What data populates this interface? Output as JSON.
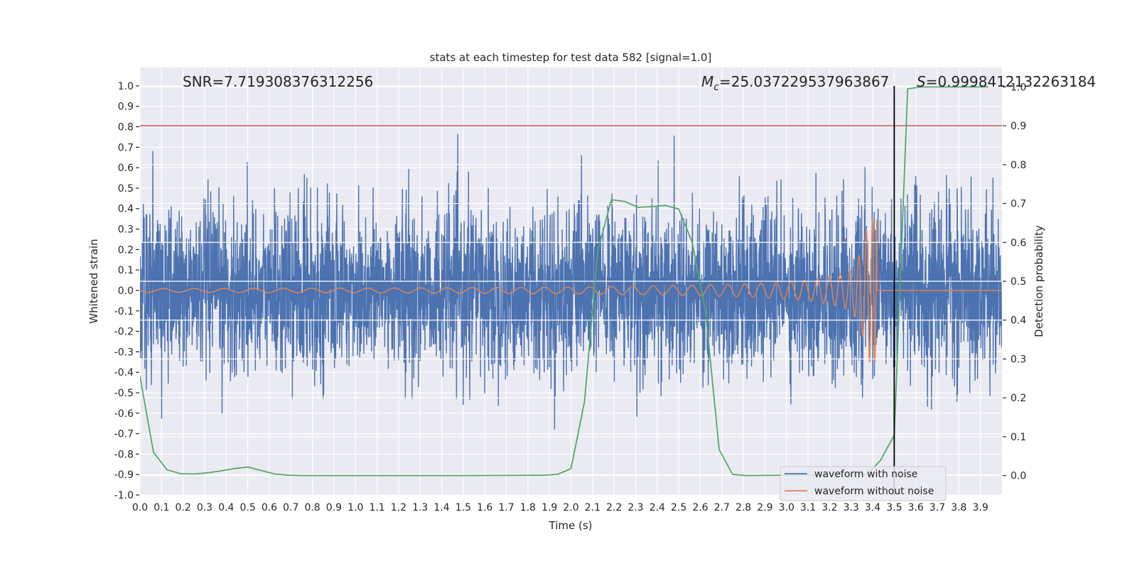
{
  "chart_data": {
    "type": "line",
    "title": "stats at each timestep for test data 582 [signal=1.0]",
    "xlabel": "Time (s)",
    "ylabel": "Whitened strain",
    "y2label": "Detection probability",
    "xlim": [
      0.0,
      4.0
    ],
    "ylim": [
      -1.0,
      1.09
    ],
    "y2lim": [
      -0.05,
      1.05
    ],
    "grid": true,
    "legend_placement": "lower-right",
    "xticks": [
      "0.0",
      "0.1",
      "0.2",
      "0.3",
      "0.4",
      "0.5",
      "0.6",
      "0.7",
      "0.8",
      "0.9",
      "1.0",
      "1.1",
      "1.2",
      "1.3",
      "1.4",
      "1.5",
      "1.6",
      "1.7",
      "1.8",
      "1.9",
      "2.0",
      "2.1",
      "2.2",
      "2.3",
      "2.4",
      "2.5",
      "2.6",
      "2.7",
      "2.8",
      "2.9",
      "3.0",
      "3.1",
      "3.2",
      "3.3",
      "3.4",
      "3.5",
      "3.6",
      "3.7",
      "3.8",
      "3.9"
    ],
    "yticks": [
      "-1.0",
      "-0.9",
      "-0.8",
      "-0.7",
      "-0.6",
      "-0.5",
      "-0.4",
      "-0.3",
      "-0.2",
      "-0.1",
      "0.0",
      "0.1",
      "0.2",
      "0.3",
      "0.4",
      "0.5",
      "0.6",
      "0.7",
      "0.8",
      "0.9",
      "1.0"
    ],
    "y2ticks": [
      "0.0",
      "0.1",
      "0.2",
      "0.3",
      "0.4",
      "0.5",
      "0.6",
      "0.7",
      "0.8",
      "0.9",
      "1.0"
    ],
    "annotations": {
      "snr": "SNR=7.719308376312256",
      "mc_label": "M",
      "mc_sub": "c",
      "mc_value": "=25.037229537963867",
      "s_label": "S",
      "s_value": "=0.9998412132263184"
    },
    "threshold": {
      "axis": "y2",
      "value": 0.9,
      "color": "#c44e52"
    },
    "vline": {
      "x": 3.5,
      "color": "#000000"
    },
    "series": [
      {
        "name": "waveform with noise",
        "axis": "y",
        "color": "#4c72b0",
        "kind": "noise",
        "std": 0.2,
        "range": [
          0.0,
          4.0
        ]
      },
      {
        "name": "waveform without noise",
        "axis": "y",
        "color": "#dd8452",
        "kind": "chirp",
        "end_time": 3.42,
        "peak_amplitude": 0.35
      },
      {
        "axis": "y2",
        "color": "#55a868",
        "x": [
          0.0,
          0.0625,
          0.125,
          0.1875,
          0.25,
          0.3125,
          0.375,
          0.4375,
          0.5,
          0.5625,
          0.625,
          0.6875,
          0.75,
          1.0,
          1.5,
          1.875,
          1.9375,
          2.0,
          2.0625,
          2.125,
          2.1875,
          2.25,
          2.3125,
          2.375,
          2.4375,
          2.5,
          2.5625,
          2.625,
          2.6875,
          2.75,
          2.8125,
          3.375,
          3.4375,
          3.5,
          3.5625,
          3.625,
          3.9375
        ],
        "values": [
          0.255,
          0.06,
          0.015,
          0.005,
          0.004,
          0.007,
          0.012,
          0.018,
          0.022,
          0.013,
          0.004,
          0.001,
          0.0,
          0.0,
          0.0,
          0.001,
          0.003,
          0.018,
          0.19,
          0.58,
          0.71,
          0.705,
          0.69,
          0.692,
          0.695,
          0.686,
          0.6,
          0.42,
          0.067,
          0.003,
          0.0,
          0.003,
          0.04,
          0.104,
          0.995,
          1.0,
          1.0
        ]
      }
    ]
  }
}
